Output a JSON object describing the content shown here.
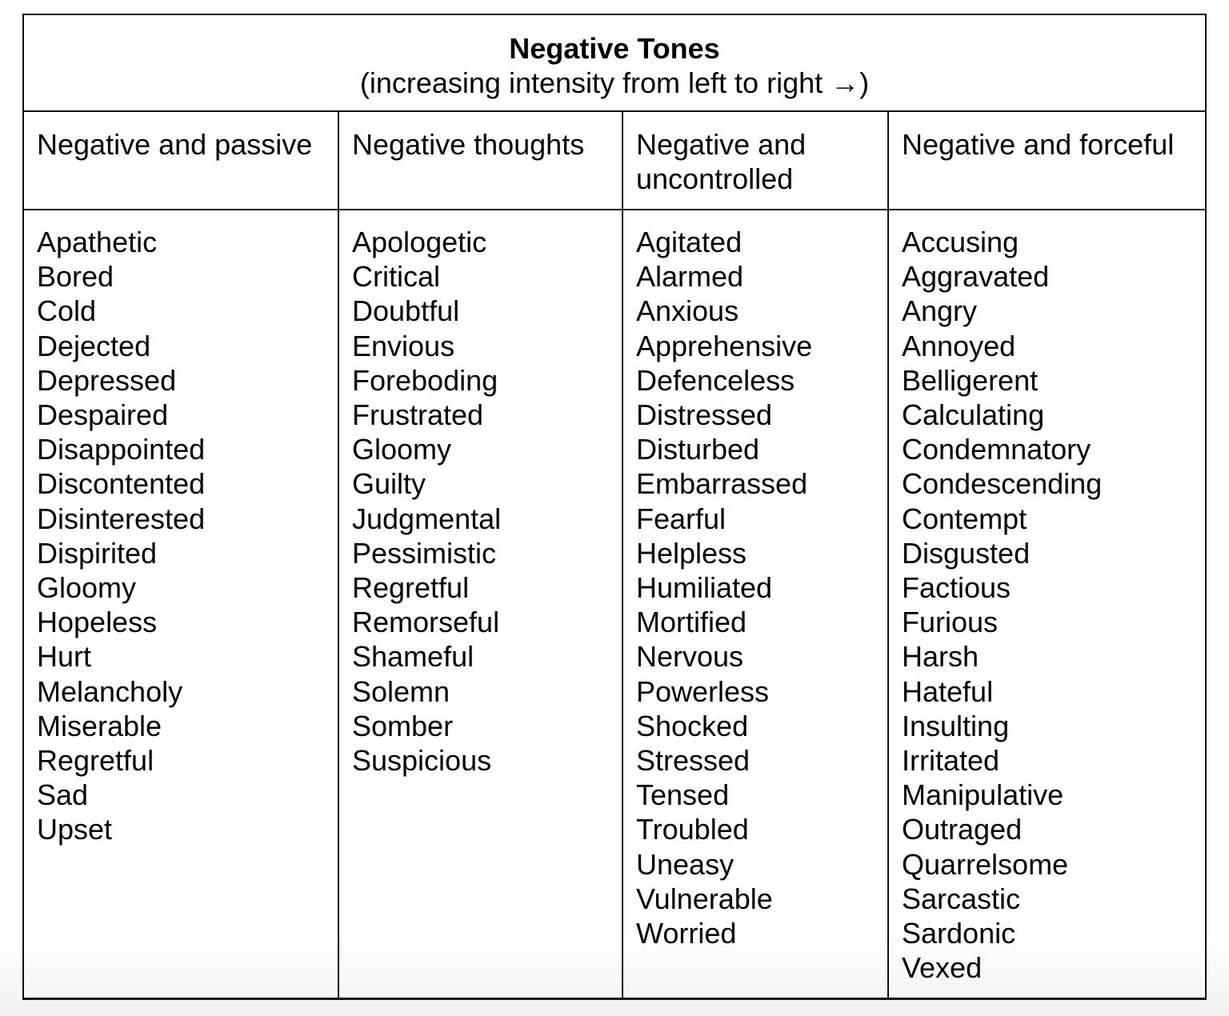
{
  "table": {
    "title": "Negative Tones",
    "subtitle": "(increasing intensity from left to right →)",
    "columns": [
      {
        "header": "Negative and passive",
        "words": [
          "Apathetic",
          "Bored",
          "Cold",
          "Dejected",
          "Depressed",
          "Despaired",
          "Disappointed",
          "Discontented",
          "Disinterested",
          "Dispirited",
          "Gloomy",
          "Hopeless",
          "Hurt",
          "Melancholy",
          "Miserable",
          "Regretful",
          "Sad",
          "Upset"
        ]
      },
      {
        "header": "Negative thoughts",
        "words": [
          "Apologetic",
          "Critical",
          "Doubtful",
          "Envious",
          "Foreboding",
          "Frustrated",
          "Gloomy",
          "Guilty",
          "Judgmental",
          "Pessimistic",
          "Regretful",
          "Remorseful",
          "Shameful",
          "Solemn",
          "Somber",
          "Suspicious"
        ]
      },
      {
        "header": "Negative and uncontrolled",
        "words": [
          "Agitated",
          "Alarmed",
          "Anxious",
          "Apprehensive",
          "Defenceless",
          "Distressed",
          "Disturbed",
          "Embarrassed",
          "Fearful",
          "Helpless",
          "Humiliated",
          "Mortified",
          "Nervous",
          "Powerless",
          "Shocked",
          "Stressed",
          "Tensed",
          "Troubled",
          "Uneasy",
          "Vulnerable",
          "Worried"
        ]
      },
      {
        "header": "Negative and forceful",
        "words": [
          "Accusing",
          "Aggravated",
          "Angry",
          "Annoyed",
          "Belligerent",
          "Calculating",
          "Condemnatory",
          "Condescending",
          "Contempt",
          "Disgusted",
          "Factious",
          "Furious",
          "Harsh",
          "Hateful",
          "Insulting",
          "Irritated",
          "Manipulative",
          "Outraged",
          "Quarrelsome",
          "Sarcastic",
          "Sardonic",
          "Vexed"
        ]
      }
    ]
  }
}
